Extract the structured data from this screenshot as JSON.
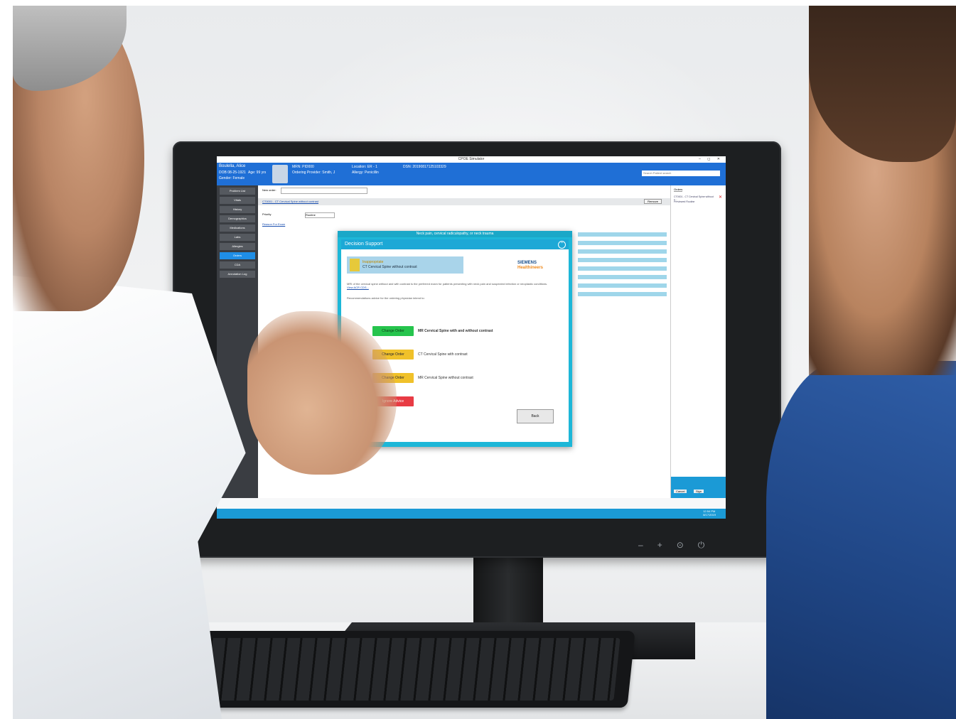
{
  "app": {
    "window_title": "CPOE Simulator",
    "window_controls": "– ◻ ✕"
  },
  "patient_header": {
    "name": "Boulella, Alice",
    "dob": "DOB 08-25-1921",
    "age": "Age: 99 yrs",
    "gender": "Gender: Female",
    "mrn": "MRN: PID000",
    "ordering_provider": "Ordering Provider: Smith, J",
    "location": "Location: ER - 1",
    "allergy": "Allergy: Penicillin",
    "dsn": "DSN: 20190817125103329",
    "search_placeholder": "Search Patient search"
  },
  "sidebar": {
    "items": [
      {
        "label": "Problem List"
      },
      {
        "label": "Vitals"
      },
      {
        "label": "History"
      },
      {
        "label": "Demographics"
      },
      {
        "label": "Medications"
      },
      {
        "label": "Labs"
      },
      {
        "label": "Allergies"
      },
      {
        "label": "Orders"
      },
      {
        "label": "CDA"
      },
      {
        "label": "Annotation Log"
      }
    ]
  },
  "orders": {
    "new_order_label": "New order:",
    "current_order": "CT0001 - CT Cervical Spine without contrast",
    "remove_label": "Remove",
    "priority_label": "Priority",
    "priority_value": "Routine",
    "reason_label": "Reason For Exam"
  },
  "right_pane": {
    "tab": "Orders",
    "item": "CT0001 - CT Cervical Spine without c...",
    "item_status": "Previewed Routine",
    "cancel_label": "Cancel",
    "sign_label": "Sign"
  },
  "modal": {
    "top_bar": "Neck pain, cervical radiculopathy, or neck trauma",
    "title": "Decision Support",
    "exam_status": "Inappropriate",
    "exam_name": "CT Cervical Spine without contrast",
    "brand_line1": "SIEMENS",
    "brand_line2": "Healthineers",
    "advice": "MRI of the cervical spine without and with contrast is the preferred exam for patients presenting with neck pain and suspected infection or neoplastic conditions.",
    "view_link": "View ACR CDS...",
    "prompt": "Recommendations advice for the ordering physician intend to:",
    "options": [
      {
        "button": "Change Order",
        "exam": "MR Cervical Spine with and without contrast",
        "color": "#26c44d"
      },
      {
        "button": "Change Order",
        "exam": "CT Cervical Spine with contrast",
        "color": "#f0c12a"
      },
      {
        "button": "Change Order",
        "exam": "MR Cervical Spine without contrast",
        "color": "#f0c12a"
      }
    ],
    "ignore_button": "Ignore Advice",
    "back_button": "Back"
  },
  "taskbar": {
    "time": "12:54 PM",
    "date": "8/17/2019"
  }
}
